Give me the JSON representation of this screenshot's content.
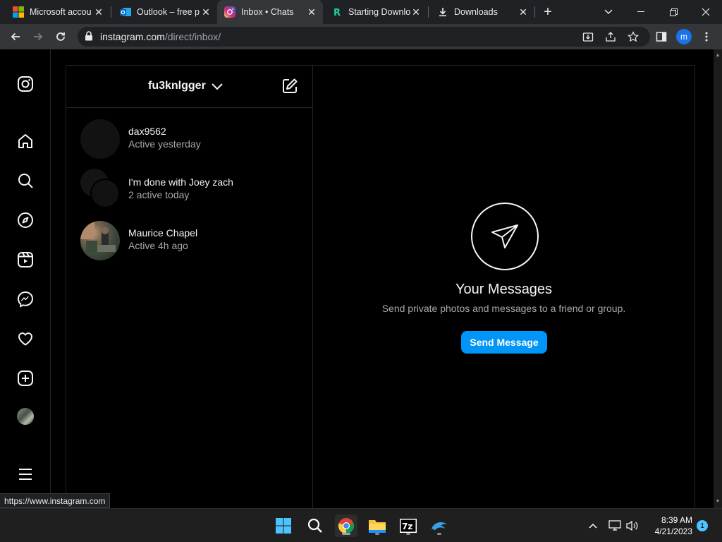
{
  "browser": {
    "tabs": [
      {
        "title": "Microsoft accou",
        "favicon": "microsoft-logo-icon",
        "active": false
      },
      {
        "title": "Outlook – free p",
        "favicon": "outlook-logo-icon",
        "active": false
      },
      {
        "title": "Inbox • Chats",
        "favicon": "instagram-logo-icon",
        "active": true
      },
      {
        "title": "Starting Downlo",
        "favicon": "r-logo-icon",
        "active": false
      },
      {
        "title": "Downloads",
        "favicon": "download-icon",
        "active": false
      }
    ],
    "url_host": "instagram.com",
    "url_path": "/direct/inbox/",
    "profile_initial": "m",
    "status_url": "https://www.instagram.com"
  },
  "sidebar": {
    "items": [
      {
        "icon": "instagram-logo-icon"
      },
      {
        "icon": "home-icon"
      },
      {
        "icon": "search-icon"
      },
      {
        "icon": "explore-compass-icon"
      },
      {
        "icon": "reels-icon"
      },
      {
        "icon": "messenger-icon"
      },
      {
        "icon": "heart-icon"
      },
      {
        "icon": "create-plus-icon"
      },
      {
        "icon": "profile-avatar"
      },
      {
        "icon": "hamburger-menu-icon"
      }
    ]
  },
  "inbox": {
    "username": "fu3knlgger",
    "conversations": [
      {
        "name": "dax9562",
        "status": "Active yesterday"
      },
      {
        "name": "I'm done with Joey zach",
        "status": "2 active today"
      },
      {
        "name": "Maurice Chapel",
        "status": "Active 4h ago"
      }
    ]
  },
  "empty_state": {
    "title": "Your Messages",
    "subtitle": "Send private photos and messages to a friend or group.",
    "button": "Send Message"
  },
  "taskbar": {
    "time": "8:39 AM",
    "date": "4/21/2023",
    "notifications": "1"
  },
  "colors": {
    "accent": "#0095f6",
    "background": "#000000",
    "secondary_text": "#a8a8a8"
  }
}
